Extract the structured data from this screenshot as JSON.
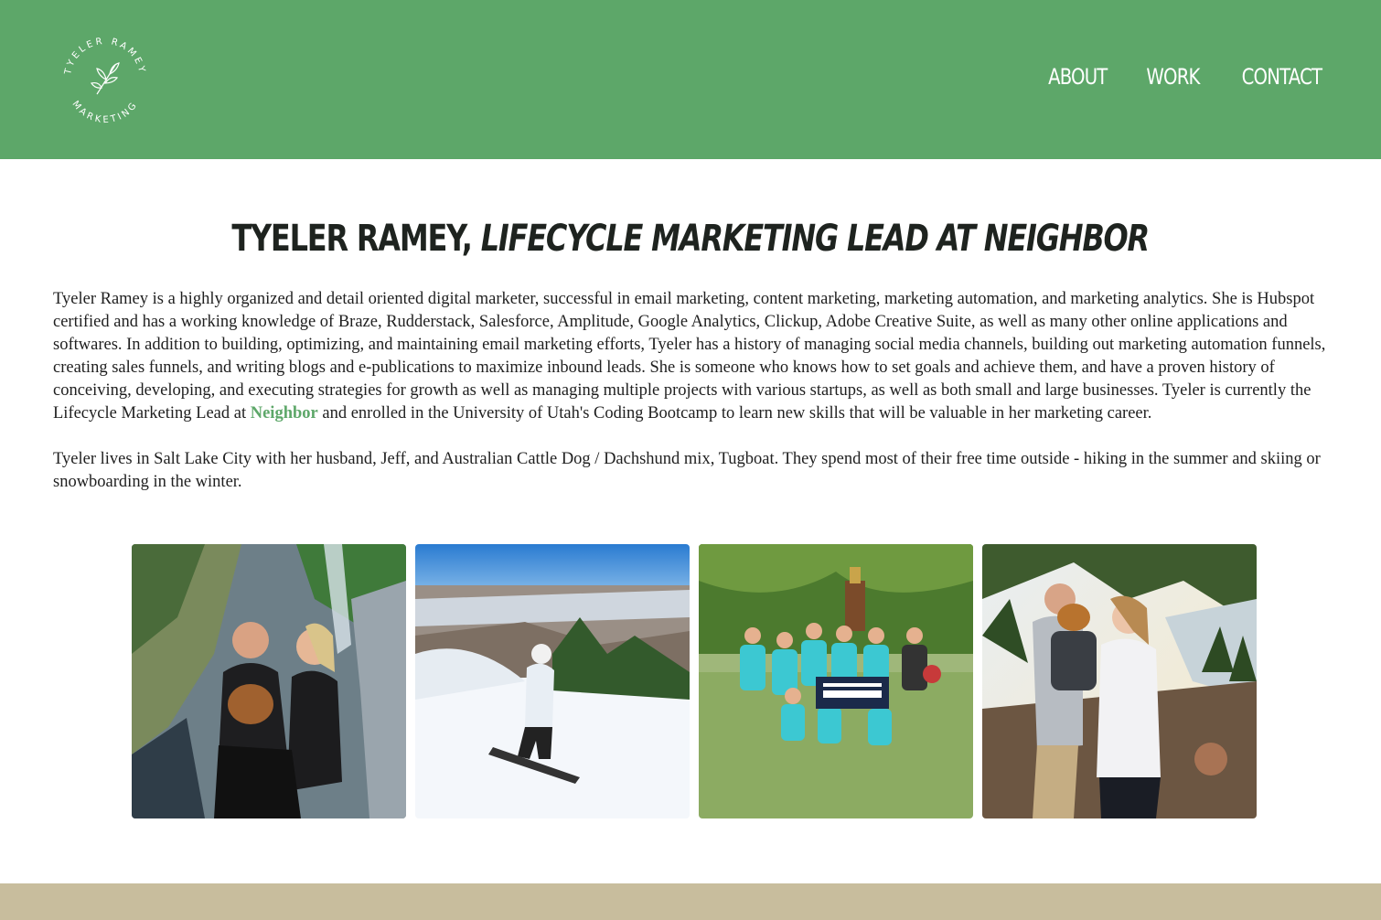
{
  "header": {
    "logo": {
      "top_text": "TYELER RAMEY",
      "bottom_text": "MARKETING",
      "icon": "leaf-branch-icon"
    },
    "nav": [
      {
        "label": "ABOUT"
      },
      {
        "label": "WORK"
      },
      {
        "label": "CONTACT"
      }
    ]
  },
  "main": {
    "title_name": "TYELER RAMEY,",
    "title_role": "LIFECYCLE MARKETING LEAD AT NEIGHBOR",
    "bio_p1_before": "Tyeler Ramey is a highly organized and detail oriented digital marketer, successful in email marketing, content marketing, marketing automation, and marketing analytics. She is Hubspot certified and has a working knowledge of Braze, Rudderstack, Salesforce, Amplitude, Google Analytics, Clickup, Adobe Creative Suite, as well as many other online applications and softwares. In addition to building, optimizing, and maintaining email marketing efforts, Tyeler has a history of managing social media channels, building out marketing automation funnels, creating sales funnels, and writing blogs and e-publications to maximize inbound leads. She is someone who knows how to set goals and achieve them, and have a proven history of conceiving, developing, and executing strategies for growth as well as managing multiple projects with various startups, as well as both small and large businesses. Tyeler is currently the Lifecycle Marketing Lead at",
    "bio_link": "Neighbor",
    "bio_p1_after": "and enrolled in the University of Utah's Coding Bootcamp to learn new skills that will be valuable in her marketing career.",
    "bio_p2": "Tyeler lives in Salt Lake City with her husband, Jeff, and Australian Cattle Dog / Dachshund mix, Tugboat. They spend most of their free time outside - hiking in the summer and skiing or snowboarding in the winter."
  },
  "colors": {
    "header_bg": "#5da769",
    "link": "#5da769",
    "footer_bg": "#c8bd9d",
    "title": "#1e231f"
  }
}
